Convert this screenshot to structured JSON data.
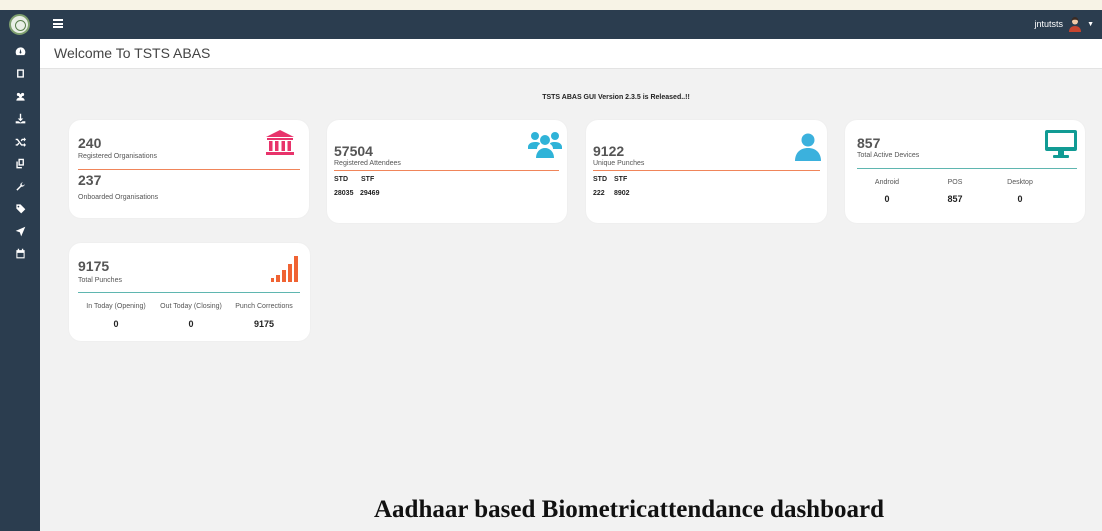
{
  "topbar": {
    "username": "jntutsts"
  },
  "header": {
    "title": "Welcome To TSTS ABAS"
  },
  "notice": "TSTS ABAS GUI Version 2.3.5 is Released..!!",
  "cards": {
    "organisations": {
      "registered_value": "240",
      "registered_label": "Registered Organisations",
      "onboarded_value": "237",
      "onboarded_label": "Onboarded Organisations",
      "icon": "bank-icon",
      "icon_color": "#e8336b"
    },
    "attendees": {
      "value": "57504",
      "label": "Registered Attendees",
      "std_label": "STD",
      "stf_label": "STF",
      "std_value": "28035",
      "stf_value": "29469",
      "icon": "users-group-icon",
      "icon_color": "#2fb3d8"
    },
    "punches_unique": {
      "value": "9122",
      "label": "Unique Punches",
      "std_label": "STD",
      "stf_label": "STF",
      "std_value": "222",
      "stf_value": "8902",
      "icon": "user-icon",
      "icon_color": "#3bb1dd"
    },
    "devices": {
      "value": "857",
      "label": "Total Active Devices",
      "cols": [
        {
          "label": "Android",
          "value": "0"
        },
        {
          "label": "POS",
          "value": "857"
        },
        {
          "label": "Desktop",
          "value": "0"
        }
      ],
      "icon": "monitor-icon",
      "icon_color": "#119b94"
    },
    "total_punches": {
      "value": "9175",
      "label": "Total Punches",
      "cols": [
        {
          "label": "In Today (Opening)",
          "value": "0"
        },
        {
          "label": "Out Today (Closing)",
          "value": "0"
        },
        {
          "label": "Punch Corrections",
          "value": "9175"
        }
      ],
      "icon": "signal-bars-icon",
      "icon_color": "#f06333"
    }
  },
  "colors": {
    "navbar": "#2b3d4f",
    "rule_orange": "#f0855a",
    "rule_teal": "#5fb6b0"
  },
  "sidebar_icons": [
    "dashboard-icon",
    "tablet-icon",
    "users-icon",
    "download-icon",
    "shuffle-icon",
    "copy-icon",
    "wrench-icon",
    "tag-icon",
    "location-arrow-icon",
    "calendar-icon"
  ],
  "caption": "Aadhaar based Biometricattendance dashboard"
}
